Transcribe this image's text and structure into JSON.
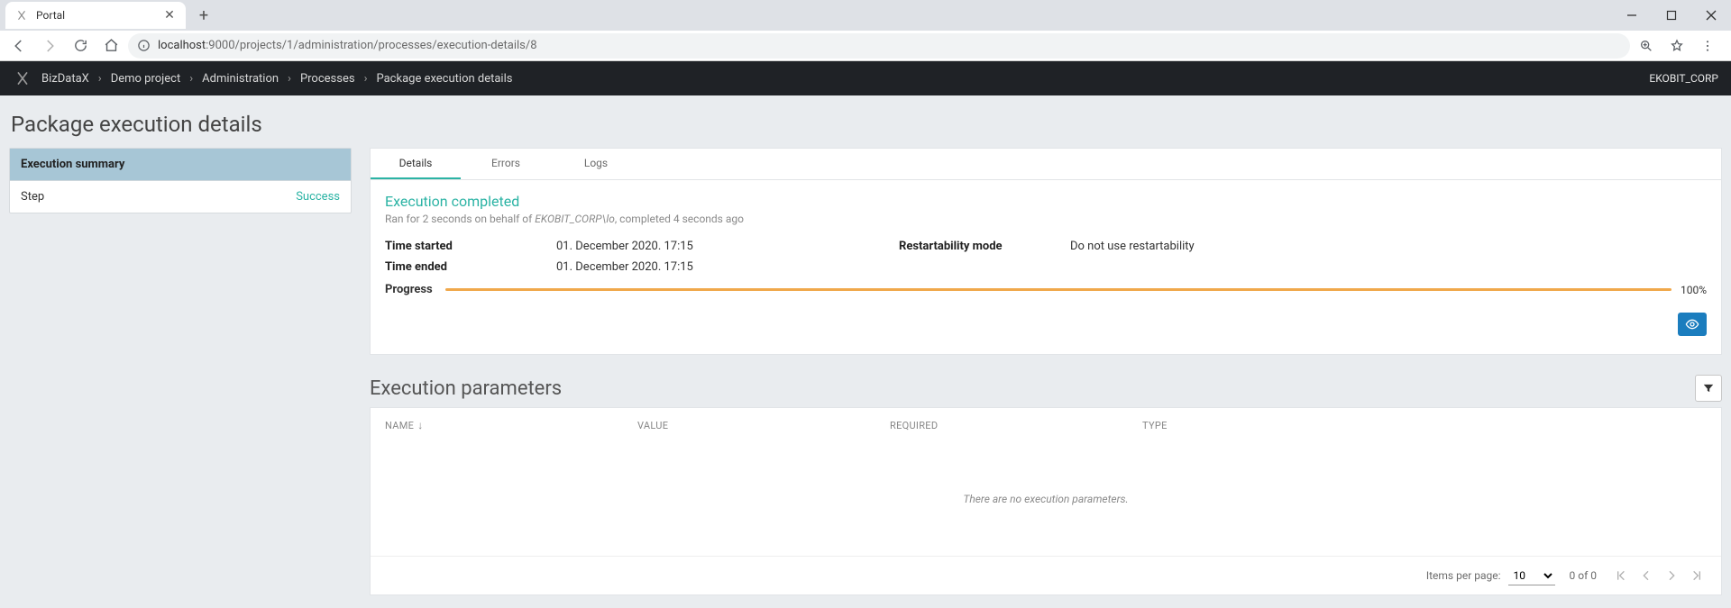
{
  "browser": {
    "tab_title": "Portal",
    "url_host": "localhost",
    "url_path": ":9000/projects/1/administration/processes/execution-details/8"
  },
  "header": {
    "breadcrumbs": [
      "BizDataX",
      "Demo project",
      "Administration",
      "Processes",
      "Package execution details"
    ],
    "tenant": "EKOBIT_CORP"
  },
  "page_title": "Package execution details",
  "sidebar": {
    "header": "Execution summary",
    "rows": [
      {
        "label": "Step",
        "status": "Success"
      }
    ]
  },
  "tabs": [
    {
      "label": "Details",
      "active": true
    },
    {
      "label": "Errors",
      "active": false
    },
    {
      "label": "Logs",
      "active": false
    }
  ],
  "execution": {
    "status_title": "Execution completed",
    "status_sub_pre": "Ran for 2 seconds on behalf of ",
    "status_sub_user": "EKOBIT_CORP\\lo",
    "status_sub_post": ", completed 4 seconds ago",
    "fields": {
      "time_started_label": "Time started",
      "time_started_value": "01. December 2020. 17:15",
      "time_ended_label": "Time ended",
      "time_ended_value": "01. December 2020. 17:15",
      "restart_label": "Restartability mode",
      "restart_value": "Do not use restartability",
      "progress_label": "Progress",
      "progress_pct": "100%"
    }
  },
  "params": {
    "section_title": "Execution parameters",
    "columns": {
      "name": "NAME",
      "value": "VALUE",
      "required": "REQUIRED",
      "type": "TYPE"
    },
    "empty_text": "There are no execution parameters.",
    "paginator": {
      "ipp_label": "Items per page:",
      "ipp_value": "10",
      "range": "0 of 0"
    }
  }
}
